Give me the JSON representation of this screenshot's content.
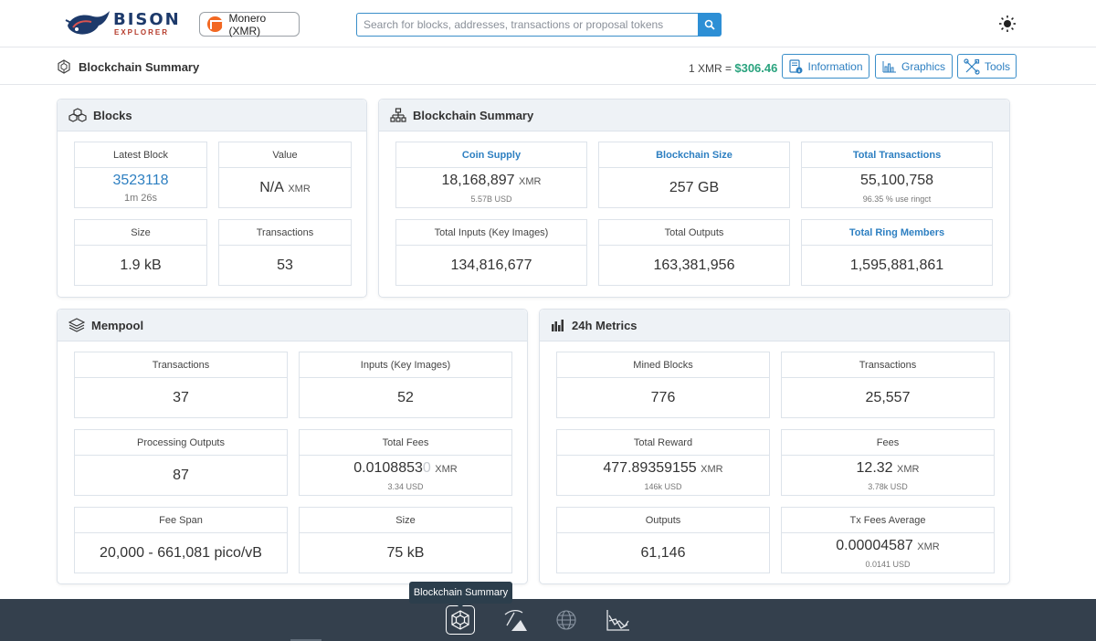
{
  "brand": {
    "title": "BISON",
    "subtitle": "EXPLORER"
  },
  "coin_selector": {
    "value": "Monero (XMR)"
  },
  "search": {
    "placeholder": "Search for blocks, addresses, transactions or proposal tokens"
  },
  "header": {
    "page_title": "Blockchain Summary",
    "price_label": "1 XMR = ",
    "price_value": "$306.46",
    "buttons": {
      "information": "Information",
      "graphics": "Graphics",
      "tools": "Tools"
    }
  },
  "blocks": {
    "title": "Blocks",
    "latest_block": {
      "label": "Latest Block",
      "value": "3523118",
      "age": "1m 26s"
    },
    "value": {
      "label": "Value",
      "value": "N/A",
      "unit": "XMR"
    },
    "size": {
      "label": "Size",
      "value": "1.9 kB"
    },
    "transactions": {
      "label": "Transactions",
      "value": "53"
    }
  },
  "summary": {
    "title": "Blockchain Summary",
    "coin_supply": {
      "label": "Coin Supply",
      "value": "18,168,897",
      "unit": "XMR",
      "sub": "5.57B USD"
    },
    "blockchain_size": {
      "label": "Blockchain Size",
      "value": "257 GB"
    },
    "total_transactions": {
      "label": "Total Transactions",
      "value": "55,100,758",
      "sub": "96.35 % use ringct"
    },
    "total_inputs": {
      "label": "Total Inputs (Key Images)",
      "value": "134,816,677"
    },
    "total_outputs": {
      "label": "Total Outputs",
      "value": "163,381,956"
    },
    "total_ring_members": {
      "label": "Total Ring Members",
      "value": "1,595,881,861"
    }
  },
  "mempool": {
    "title": "Mempool",
    "transactions": {
      "label": "Transactions",
      "value": "37"
    },
    "inputs": {
      "label": "Inputs (Key Images)",
      "value": "52"
    },
    "processing_outputs": {
      "label": "Processing Outputs",
      "value": "87"
    },
    "total_fees": {
      "label": "Total Fees",
      "value_main": "0.0108853",
      "value_faded": "0",
      "unit": "XMR",
      "sub": "3.34 USD"
    },
    "fee_span": {
      "label": "Fee Span",
      "value": "20,000 - 661,081 pico/vB"
    },
    "size": {
      "label": "Size",
      "value": "75 kB"
    }
  },
  "metrics": {
    "title": "24h Metrics",
    "mined_blocks": {
      "label": "Mined Blocks",
      "value": "776"
    },
    "transactions": {
      "label": "Transactions",
      "value": "25,557"
    },
    "total_reward": {
      "label": "Total Reward",
      "value": "477.89359155",
      "unit": "XMR",
      "sub": "146k USD"
    },
    "fees": {
      "label": "Fees",
      "value": "12.32",
      "unit": "XMR",
      "sub": "3.78k USD"
    },
    "outputs": {
      "label": "Outputs",
      "value": "61,146"
    },
    "tx_fees_average": {
      "label": "Tx Fees Average",
      "value": "0.00004587",
      "unit": "XMR",
      "sub": "0.0141 USD"
    }
  },
  "bottom_nav": {
    "tooltip": "Blockchain Summary"
  },
  "colors": {
    "accent": "#2d7fc1",
    "price": "#2aa37e",
    "bottom_bar": "#34404d",
    "xmr": "#f26822"
  }
}
